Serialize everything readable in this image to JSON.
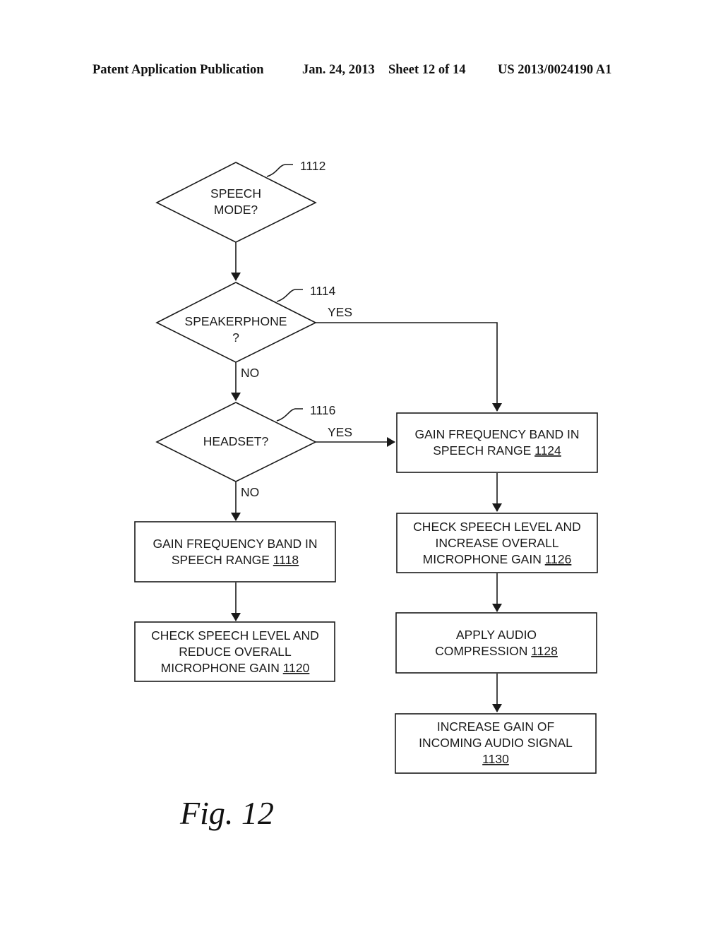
{
  "header": {
    "publication": "Patent Application Publication",
    "date": "Jan. 24, 2013",
    "sheet": "Sheet 12 of 14",
    "number": "US 2013/0024190 A1"
  },
  "figure_label": "Fig. 12",
  "nodes": {
    "n1112": {
      "type": "decision",
      "ref": "1112",
      "lines": [
        "SPEECH",
        "MODE?"
      ]
    },
    "n1114": {
      "type": "decision",
      "ref": "1114",
      "lines": [
        "SPEAKERPHONE",
        "?"
      ]
    },
    "n1116": {
      "type": "decision",
      "ref": "1116",
      "lines": [
        "HEADSET?"
      ]
    },
    "n1118": {
      "type": "process",
      "ref": "1118",
      "lines": [
        "GAIN FREQUENCY BAND IN",
        "SPEECH RANGE "
      ]
    },
    "n1120": {
      "type": "process",
      "ref": "1120",
      "lines": [
        "CHECK SPEECH LEVEL AND",
        "REDUCE OVERALL",
        "MICROPHONE GAIN "
      ]
    },
    "n1124": {
      "type": "process",
      "ref": "1124",
      "lines": [
        "GAIN FREQUENCY BAND IN",
        "SPEECH RANGE "
      ]
    },
    "n1126": {
      "type": "process",
      "ref": "1126",
      "lines": [
        "CHECK SPEECH LEVEL AND",
        "INCREASE OVERALL",
        "MICROPHONE GAIN "
      ]
    },
    "n1128": {
      "type": "process",
      "ref": "1128",
      "lines": [
        "APPLY AUDIO",
        "COMPRESSION "
      ]
    },
    "n1130": {
      "type": "process",
      "ref": "1130",
      "lines": [
        "INCREASE GAIN OF",
        "INCOMING AUDIO SIGNAL",
        ""
      ]
    }
  },
  "edges": [
    {
      "from": "1112",
      "to": "1114",
      "label": ""
    },
    {
      "from": "1114",
      "to": "1124",
      "label": "YES"
    },
    {
      "from": "1114",
      "to": "1116",
      "label": "NO"
    },
    {
      "from": "1116",
      "to": "1124",
      "label": "YES"
    },
    {
      "from": "1116",
      "to": "1118",
      "label": "NO"
    },
    {
      "from": "1118",
      "to": "1120",
      "label": ""
    },
    {
      "from": "1124",
      "to": "1126",
      "label": ""
    },
    {
      "from": "1126",
      "to": "1128",
      "label": ""
    },
    {
      "from": "1128",
      "to": "1130",
      "label": ""
    }
  ]
}
